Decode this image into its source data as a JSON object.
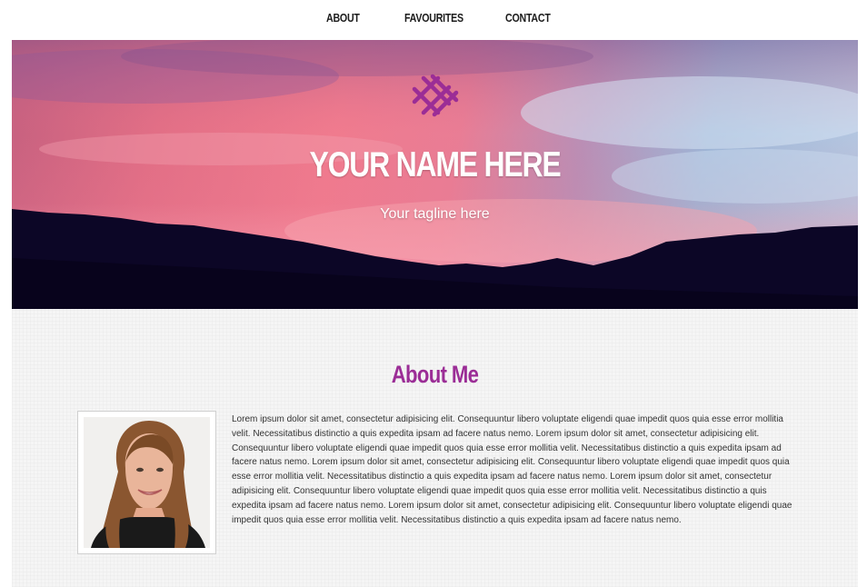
{
  "nav": {
    "items": [
      {
        "label": "ABOUT"
      },
      {
        "label": "FAVOURITES"
      },
      {
        "label": "CONTACT"
      }
    ]
  },
  "hero": {
    "logo_icon": "crosshatch-logo-icon",
    "title": "YOUR NAME HERE",
    "tagline": "Your tagline here"
  },
  "about": {
    "heading": "About Me",
    "photo_icon": "profile-photo",
    "body": "Lorem ipsum dolor sit amet, consectetur adipisicing elit. Consequuntur libero voluptate eligendi quae impedit quos quia esse error mollitia velit. Necessitatibus distinctio a quis expedita ipsam ad facere natus nemo. Lorem ipsum dolor sit amet, consectetur adipisicing elit. Consequuntur libero voluptate eligendi quae impedit quos quia esse error mollitia velit. Necessitatibus distinctio a quis expedita ipsam ad facere natus nemo. Lorem ipsum dolor sit amet, consectetur adipisicing elit. Consequuntur libero voluptate eligendi quae impedit quos quia esse error mollitia velit. Necessitatibus distinctio a quis expedita ipsam ad facere natus nemo. Lorem ipsum dolor sit amet, consectetur adipisicing elit. Consequuntur libero voluptate eligendi quae impedit quos quia esse error mollitia velit. Necessitatibus distinctio a quis expedita ipsam ad facere natus nemo. Lorem ipsum dolor sit amet, consectetur adipisicing elit. Consequuntur libero voluptate eligendi quae impedit quos quia esse error mollitia velit. Necessitatibus distinctio a quis expedita ipsam ad facere natus nemo."
  },
  "colors": {
    "accent": "#9b2d96",
    "nav_text": "#1c1c1c",
    "mountain": "#0c0626"
  }
}
